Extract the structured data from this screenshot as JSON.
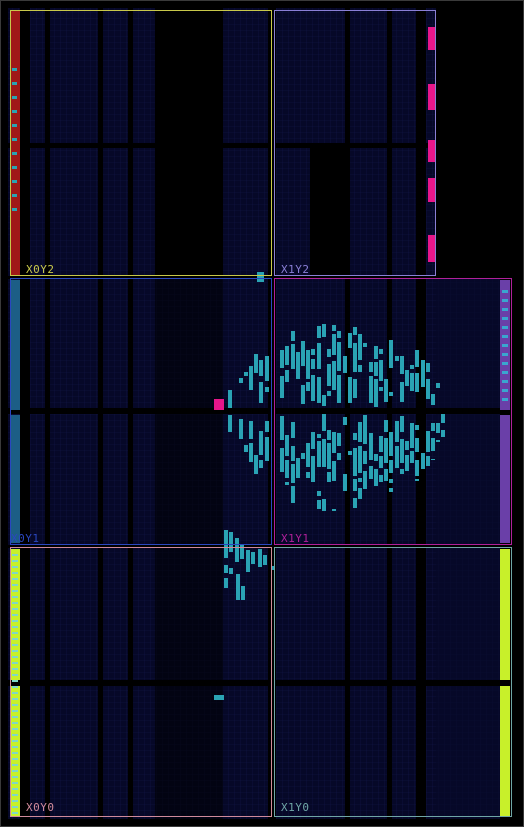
{
  "app": {
    "view": "Device"
  },
  "colors": {
    "background": "#000000",
    "fabric": "#060828",
    "grid": "#141a4a",
    "placed_cell": "#2aa3b4",
    "highlight": "#e8168a",
    "region_x0y2": "#c8c84a",
    "region_x1y2": "#8a7fd6",
    "region_x0y1": "#2a47c0",
    "region_x1y1": "#b0209a",
    "region_x0y0": "#d08a9a",
    "region_x1y0": "#6fa6a6",
    "io_red": "#a01818",
    "io_teal": "#1c5e86",
    "io_purple": "#6a3fa8",
    "io_lime": "#c8f02a",
    "io_cyan": "#7fd8c8"
  },
  "clock_regions": [
    {
      "id": "x0y2",
      "label": "X0Y2"
    },
    {
      "id": "x1y2",
      "label": "X1Y2"
    },
    {
      "id": "x0y1",
      "label": "X0Y1"
    },
    {
      "id": "x1y1",
      "label": "X1Y1"
    },
    {
      "id": "x0y0",
      "label": "X0Y0"
    },
    {
      "id": "x1y0",
      "label": "X1Y0"
    }
  ]
}
